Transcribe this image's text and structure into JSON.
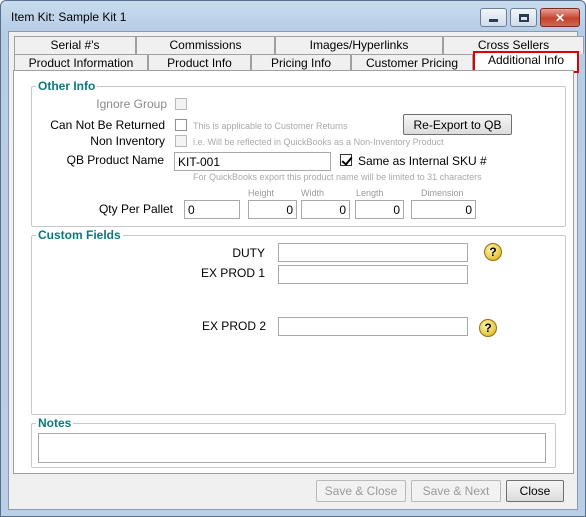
{
  "window": {
    "title": "Item Kit: Sample Kit 1"
  },
  "tabs_row1": [
    "Serial #'s",
    "Commissions",
    "Images/Hyperlinks",
    "Cross Sellers"
  ],
  "tabs_row2": [
    "Product Information",
    "Product Info",
    "Pricing Info",
    "Customer Pricing",
    "Additional Info"
  ],
  "other_info": {
    "legend": "Other Info",
    "ignore_group_label": "Ignore Group",
    "ignore_group_checked": false,
    "can_not_be_returned_label": "Can Not Be Returned",
    "can_not_be_returned_hint": "This is applicable to Customer Returns",
    "can_not_be_returned_checked": false,
    "non_inventory_label": "Non Inventory",
    "non_inventory_hint": "i.e. Will be reflected in QuickBooks as a Non-Inventory Product",
    "non_inventory_checked": false,
    "reexport_button": "Re-Export to QB",
    "qb_product_name_label": "QB Product Name",
    "qb_product_name_value": "KIT-001",
    "same_as_sku_label": "Same as Internal SKU #",
    "same_as_sku_checked": true,
    "qb_note": "For QuickBooks export this product name will be limited to 31 characters",
    "height_label": "Height",
    "width_label": "Width",
    "length_label": "Length",
    "dimension_label": "Dimension",
    "qty_per_pallet_label": "Qty Per Pallet",
    "qty_per_pallet_value": "0",
    "height_value": "0",
    "width_value": "0",
    "length_value": "0",
    "dimension_value": "0"
  },
  "custom_fields": {
    "legend": "Custom Fields",
    "duty_label": "DUTY",
    "duty_value": "",
    "ex_prod1_label": "EX PROD 1",
    "ex_prod1_value": "",
    "ex_prod2_label": "EX PROD 2",
    "ex_prod2_value": "",
    "help_glyph": "?"
  },
  "notes": {
    "legend": "Notes",
    "value": ""
  },
  "footer": {
    "save_close": "Save & Close",
    "save_next": "Save & Next",
    "close": "Close"
  },
  "icons": [
    "minimize-icon",
    "maximize-icon",
    "close-icon",
    "help-icon"
  ],
  "colors": {
    "accent_legend": "#0a7a7a",
    "active_tab_border": "#e00000"
  }
}
